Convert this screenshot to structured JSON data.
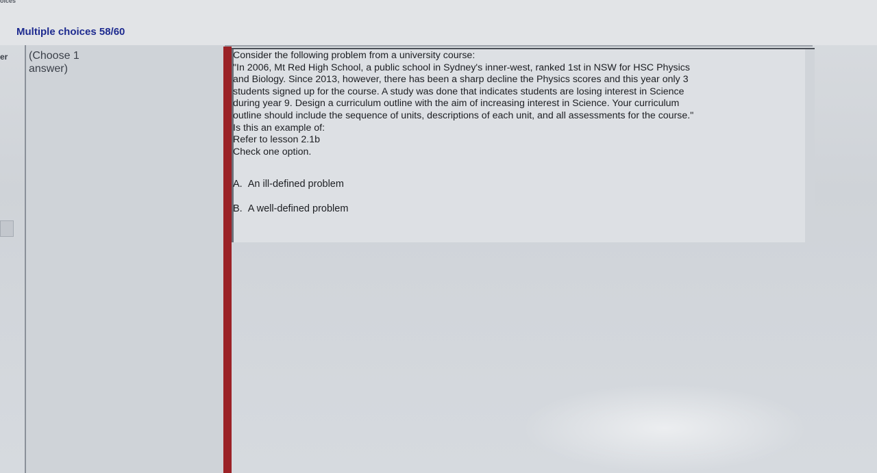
{
  "header": {
    "top_fragment": "oices",
    "title": "Multiple choices 58/60",
    "left_fragment": "er"
  },
  "question_panel": {
    "instruction_lines": [
      "(Choose 1",
      "answer)"
    ],
    "question_lines": [
      "Consider the following problem from a university course:",
      "\"In 2006, Mt Red High School, a public school in Sydney's inner-west, ranked 1st in NSW for HSC Physics",
      "and Biology. Since 2013, however, there has been a sharp decline the Physics scores and this year only 3",
      "students signed up for the course. A study was done that indicates students are losing interest in Science",
      "during year 9. Design a curriculum outline with the aim of increasing interest in Science. Your curriculum",
      "outline should include the sequence of units, descriptions of each unit, and all assessments for the course.\"",
      "Is this an example of:",
      "Refer to lesson 2.1b",
      "Check one option."
    ],
    "options": [
      {
        "letter": "A.",
        "text": "An ill-defined problem"
      },
      {
        "letter": "B.",
        "text": "A well-defined problem"
      }
    ]
  },
  "colors": {
    "title": "#1d2a8f",
    "accent_bar": "#9b2227",
    "panel_bg": "#dde0e4"
  }
}
